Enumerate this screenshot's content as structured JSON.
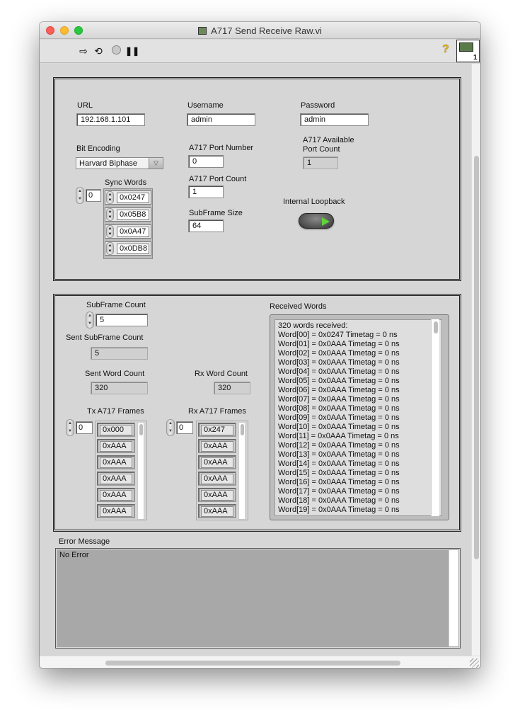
{
  "window": {
    "title": "A717 Send Receive Raw.vi"
  },
  "toolbar": {
    "run_icon": "run-arrow-icon",
    "continuous_icon": "run-continuous-icon",
    "abort_icon": "abort-icon",
    "pause_icon": "pause-icon",
    "help_glyph": "?",
    "connector_label": "1"
  },
  "config": {
    "url": {
      "label": "URL",
      "value": "192.168.1.101"
    },
    "username": {
      "label": "Username",
      "value": "admin"
    },
    "password": {
      "label": "Password",
      "value": "admin"
    },
    "bit_encoding": {
      "label": "Bit Encoding",
      "value": "Harvard Biphase"
    },
    "port_number": {
      "label": "A717 Port Number",
      "value": "0"
    },
    "port_count": {
      "label": "A717 Port Count",
      "value": "1"
    },
    "subframe_size": {
      "label": "SubFrame Size",
      "value": "64"
    },
    "available_ports": {
      "label_line1": "A717 Available",
      "label_line2": "Port Count",
      "value": "1"
    },
    "internal_loopback": {
      "label": "Internal Loopback",
      "state": "on",
      "led_color": "#5fd43a"
    },
    "sync_words": {
      "label": "Sync Words",
      "index": "0",
      "items": [
        "0x0247",
        "0x05B8",
        "0x0A47",
        "0x0DB8"
      ]
    }
  },
  "transfer": {
    "subframe_count": {
      "label": "SubFrame Count",
      "value": "5"
    },
    "sent_subframe_count": {
      "label": "Sent SubFrame Count",
      "value": "5"
    },
    "sent_word_count": {
      "label": "Sent Word Count",
      "value": "320"
    },
    "rx_word_count": {
      "label": "Rx Word Count",
      "value": "320"
    },
    "tx_frames": {
      "label": "Tx A717 Frames",
      "index": "0",
      "items": [
        "0x000",
        "0xAAA",
        "0xAAA",
        "0xAAA",
        "0xAAA",
        "0xAAA"
      ]
    },
    "rx_frames": {
      "label": "Rx A717 Frames",
      "index": "0",
      "items": [
        "0x247",
        "0xAAA",
        "0xAAA",
        "0xAAA",
        "0xAAA",
        "0xAAA"
      ]
    },
    "received_words": {
      "label": "Received Words",
      "lines": [
        "320 words received:",
        "Word[00] = 0x0247 Timetag = 0 ns",
        "Word[01] = 0x0AAA Timetag = 0 ns",
        "Word[02] = 0x0AAA Timetag = 0 ns",
        "Word[03] = 0x0AAA Timetag = 0 ns",
        "Word[04] = 0x0AAA Timetag = 0 ns",
        "Word[05] = 0x0AAA Timetag = 0 ns",
        "Word[06] = 0x0AAA Timetag = 0 ns",
        "Word[07] = 0x0AAA Timetag = 0 ns",
        "Word[08] = 0x0AAA Timetag = 0 ns",
        "Word[09] = 0x0AAA Timetag = 0 ns",
        "Word[10] = 0x0AAA Timetag = 0 ns",
        "Word[11] = 0x0AAA Timetag = 0 ns",
        "Word[12] = 0x0AAA Timetag = 0 ns",
        "Word[13] = 0x0AAA Timetag = 0 ns",
        "Word[14] = 0x0AAA Timetag = 0 ns",
        "Word[15] = 0x0AAA Timetag = 0 ns",
        "Word[16] = 0x0AAA Timetag = 0 ns",
        "Word[17] = 0x0AAA Timetag = 0 ns",
        "Word[18] = 0x0AAA Timetag = 0 ns",
        "Word[19] = 0x0AAA Timetag = 0 ns"
      ]
    }
  },
  "error": {
    "label": "Error Message",
    "value": "No Error"
  }
}
